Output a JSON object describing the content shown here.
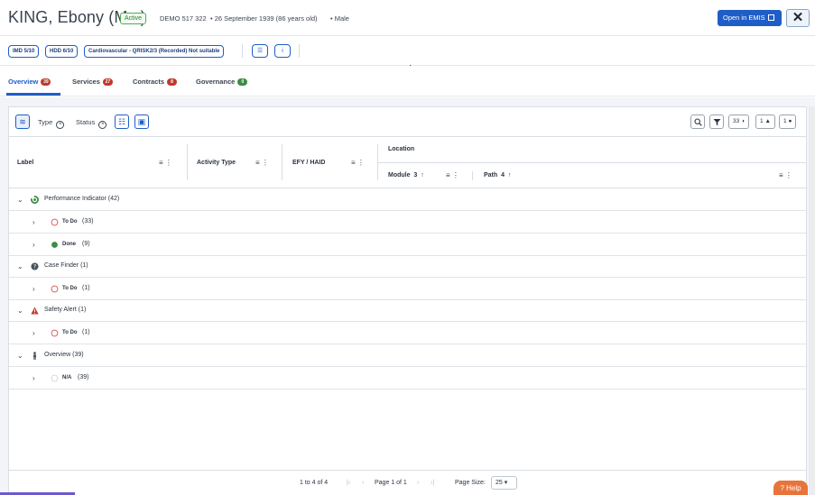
{
  "patient": {
    "name": "KING, Ebony (Mx.)",
    "status": "Active",
    "demo_id": "DEMO 517 322",
    "dob": "• 26 September 1939 (86 years old)",
    "sex": "• Male"
  },
  "header_actions": {
    "open_emis": "Open in EMIS",
    "close": "✕"
  },
  "chips": [
    {
      "label": "IMD 5/10"
    },
    {
      "label": "HDD 6/10"
    },
    {
      "label": "Cardiovascular - QRISK2/3 (Recorded) Not suitable"
    }
  ],
  "chip_buttons": {
    "layout": "☰",
    "info": "i"
  },
  "tabs": [
    {
      "label": "Overview",
      "count": "39",
      "color": "red"
    },
    {
      "label": "Services",
      "count": "27",
      "color": "red"
    },
    {
      "label": "Contracts",
      "count": "8",
      "color": "red"
    },
    {
      "label": "Governance",
      "count": "0",
      "color": "green"
    }
  ],
  "toolbar": {
    "filters": [
      {
        "label": "Type"
      },
      {
        "label": "Status"
      }
    ],
    "counters": {
      "todo": "33",
      "safety": "1",
      "case": "1"
    }
  },
  "columns": {
    "label": "Label",
    "activity_type": "Activity Type",
    "efy_haid": "EFY / HAID",
    "location": "Location",
    "module": "Module",
    "module_sort": "3",
    "path": "Path",
    "path_sort": "4"
  },
  "rows": [
    {
      "label": "Performance Indicator (42)",
      "icon": "performance-indicator-icon"
    },
    {
      "status": "To Do",
      "count": "(33)",
      "icon": "todo-circle-icon"
    },
    {
      "status": "Done",
      "count": "(9)",
      "icon": "done-dot-icon"
    },
    {
      "label": "Case Finder (1)",
      "icon": "question-circle-icon"
    },
    {
      "status": "To Do",
      "count": "(1)",
      "icon": "todo-circle-icon"
    },
    {
      "label": "Safety Alert (1)",
      "icon": "warning-triangle-icon"
    },
    {
      "status": "To Do",
      "count": "(1)",
      "icon": "todo-circle-icon"
    },
    {
      "label": "Overview (39)",
      "icon": "person-icon"
    },
    {
      "status": "N/A",
      "count": "(39)",
      "icon": "na-circle-icon"
    }
  ],
  "footer": {
    "range": "1 to 4 of 4",
    "page": "Page 1 of 1",
    "page_size_label": "Page Size:",
    "page_size": "25"
  },
  "help": "? Help",
  "colors": {
    "accent": "#1f5ec6",
    "active_green": "#4caf50",
    "alert_red": "#c0392b",
    "help_orange": "#e8743b"
  }
}
